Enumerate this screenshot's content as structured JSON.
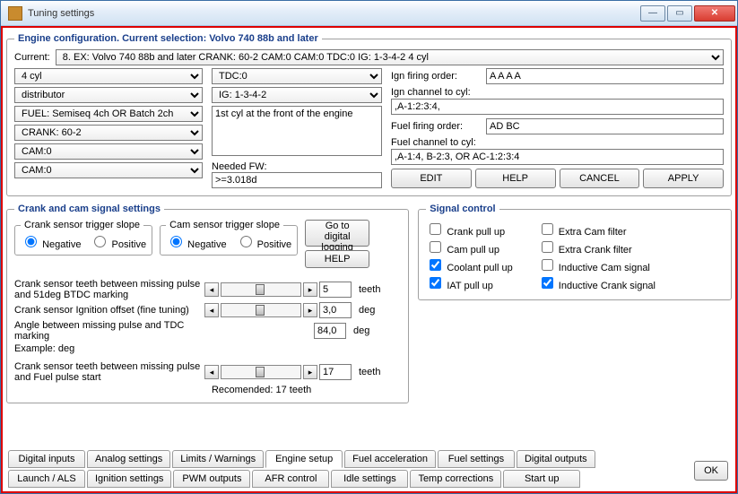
{
  "window": {
    "title": "Tuning settings"
  },
  "engine": {
    "legend": "Engine configuration.   Current selection:  Volvo 740 88b and later",
    "current_label": "Current:",
    "current_value": "8.    EX: Volvo 740 88b and later CRANK: 60-2  CAM:0  CAM:0  TDC:0  IG: 1-3-4-2  4 cyl",
    "col1": [
      "4 cyl",
      "distributor",
      "FUEL: Semiseq 4ch OR Batch 2ch",
      "CRANK: 60-2",
      "CAM:0",
      "CAM:0"
    ],
    "tdc": "TDC:0",
    "ig": "IG: 1-3-4-2",
    "note": "1st cyl at the front of the engine",
    "needed_fw_label": "Needed FW:",
    "needed_fw": ">=3.018d",
    "ign_firing_order_label": "Ign firing order:",
    "ign_firing_order": "A A A A",
    "ign_channel_label": "Ign channel to cyl:",
    "ign_channel": ",A-1:2:3:4,",
    "fuel_firing_order_label": "Fuel firing order:",
    "fuel_firing_order": "AD BC",
    "fuel_channel_label": "Fuel channel to cyl:",
    "fuel_channel": ",A-1:4, B-2:3, OR AC-1:2:3:4",
    "btn_edit": "EDIT",
    "btn_help": "HELP",
    "btn_cancel": "CANCEL",
    "btn_apply": "APPLY"
  },
  "crank": {
    "legend": "Crank and cam signal settings",
    "crank_slope_legend": "Crank sensor trigger slope",
    "cam_slope_legend": "Cam sensor trigger slope",
    "negative": "Negative",
    "positive": "Positive",
    "go_digital": "Go to digital logging",
    "help": "HELP",
    "s1_label": "Crank sensor teeth between missing pulse and 51deg BTDC marking",
    "s1_val": "5",
    "s1_unit": "teeth",
    "s2_label": "Crank sensor Ignition offset (fine tuning)",
    "s2_val": "3,0",
    "s2_unit": "deg",
    "s3_label": "Angle between missing pulse and TDC marking",
    "s3_val": "84,0",
    "s3_unit": "deg",
    "s3_example": "Example: deg",
    "s4_label": "Crank sensor teeth between missing pulse and Fuel pulse start",
    "s4_val": "17",
    "s4_unit": "teeth",
    "recommended": "Recomended: 17 teeth"
  },
  "signal": {
    "legend": "Signal control",
    "left": [
      "Crank pull up",
      "Cam pull up",
      "Coolant pull up",
      "IAT pull up"
    ],
    "right": [
      "Extra Cam filter",
      "Extra Crank filter",
      "Inductive Cam signal",
      "Inductive Crank signal"
    ],
    "left_checked": [
      false,
      false,
      true,
      true
    ],
    "right_checked": [
      false,
      false,
      false,
      true
    ]
  },
  "tabs": {
    "row1": [
      "Digital inputs",
      "Analog settings",
      "Limits / Warnings",
      "Engine setup",
      "Fuel acceleration",
      "Fuel settings",
      "Digital outputs"
    ],
    "row2": [
      "Launch / ALS",
      "Ignition settings",
      "PWM outputs",
      "AFR control",
      "Idle settings",
      "Temp corrections",
      "Start up"
    ],
    "active_row": 0,
    "active_idx": 3
  },
  "ok": "OK"
}
